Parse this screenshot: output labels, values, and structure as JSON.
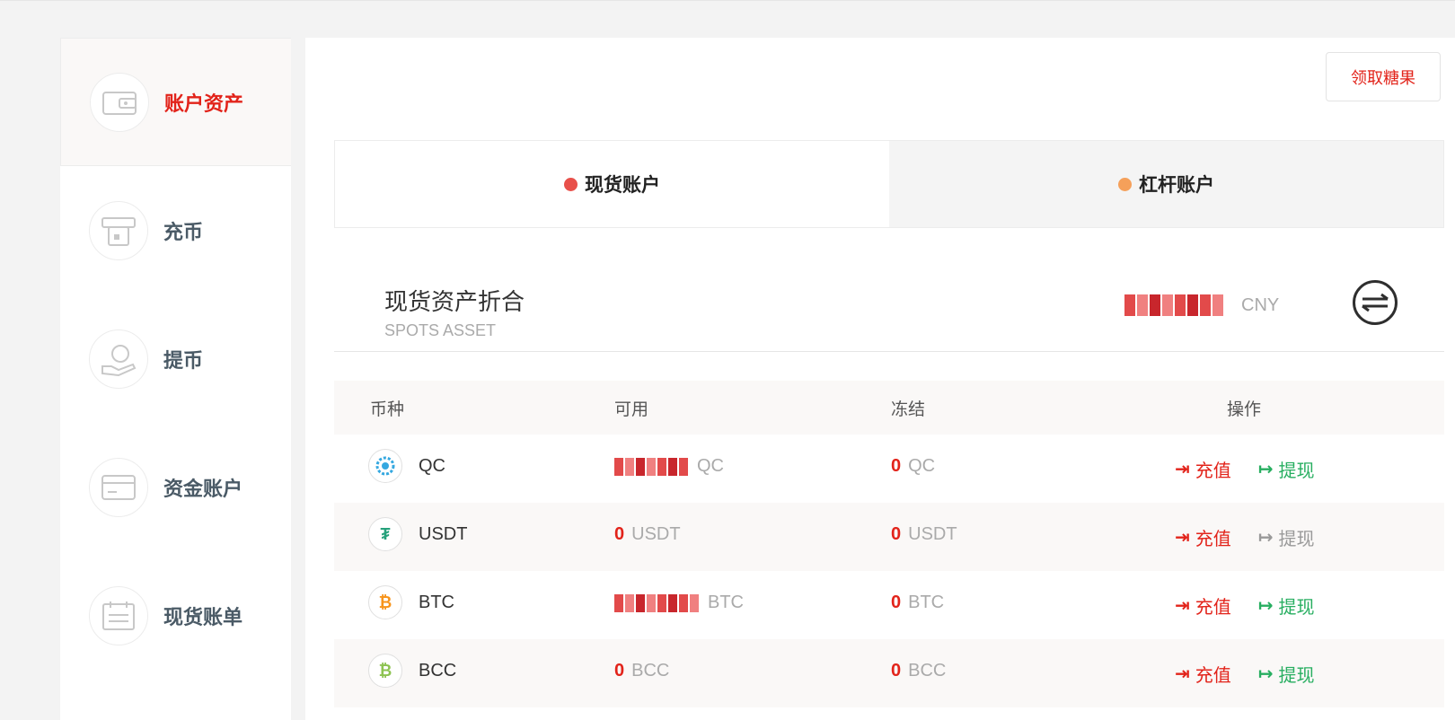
{
  "sidebar": {
    "items": [
      {
        "label": "账户资产",
        "icon": "wallet-icon",
        "active": true
      },
      {
        "label": "充币",
        "icon": "atm-icon",
        "active": false
      },
      {
        "label": "提币",
        "icon": "hand-coin-icon",
        "active": false
      },
      {
        "label": "资金账户",
        "icon": "card-icon",
        "active": false
      },
      {
        "label": "现货账单",
        "icon": "bill-icon",
        "active": false
      }
    ]
  },
  "header": {
    "candy_button": "领取糖果"
  },
  "tabs": [
    {
      "label": "现货账户",
      "dot_color": "#e8504a"
    },
    {
      "label": "杠杆账户",
      "dot_color": "#f5a05a"
    }
  ],
  "summary": {
    "title": "现货资产折合",
    "subtitle": "SPOTS ASSET",
    "unit": "CNY"
  },
  "table": {
    "headers": {
      "coin": "币种",
      "available": "可用",
      "frozen": "冻结",
      "ops": "操作"
    },
    "rows": [
      {
        "coin": "QC",
        "available_value": "",
        "available_unit": "QC",
        "frozen_value": "0",
        "frozen_unit": "QC",
        "deposit": "充值",
        "withdraw": "提现",
        "withdraw_enabled": true
      },
      {
        "coin": "USDT",
        "available_value": "0",
        "available_unit": "USDT",
        "frozen_value": "0",
        "frozen_unit": "USDT",
        "deposit": "充值",
        "withdraw": "提现",
        "withdraw_enabled": false
      },
      {
        "coin": "BTC",
        "available_value": "",
        "available_unit": "BTC",
        "frozen_value": "0",
        "frozen_unit": "BTC",
        "deposit": "充值",
        "withdraw": "提现",
        "withdraw_enabled": true
      },
      {
        "coin": "BCC",
        "available_value": "0",
        "available_unit": "BCC",
        "frozen_value": "0",
        "frozen_unit": "BCC",
        "deposit": "充值",
        "withdraw": "提现",
        "withdraw_enabled": true
      }
    ]
  },
  "colors": {
    "accent_red": "#e2231a",
    "green": "#27ae60"
  }
}
